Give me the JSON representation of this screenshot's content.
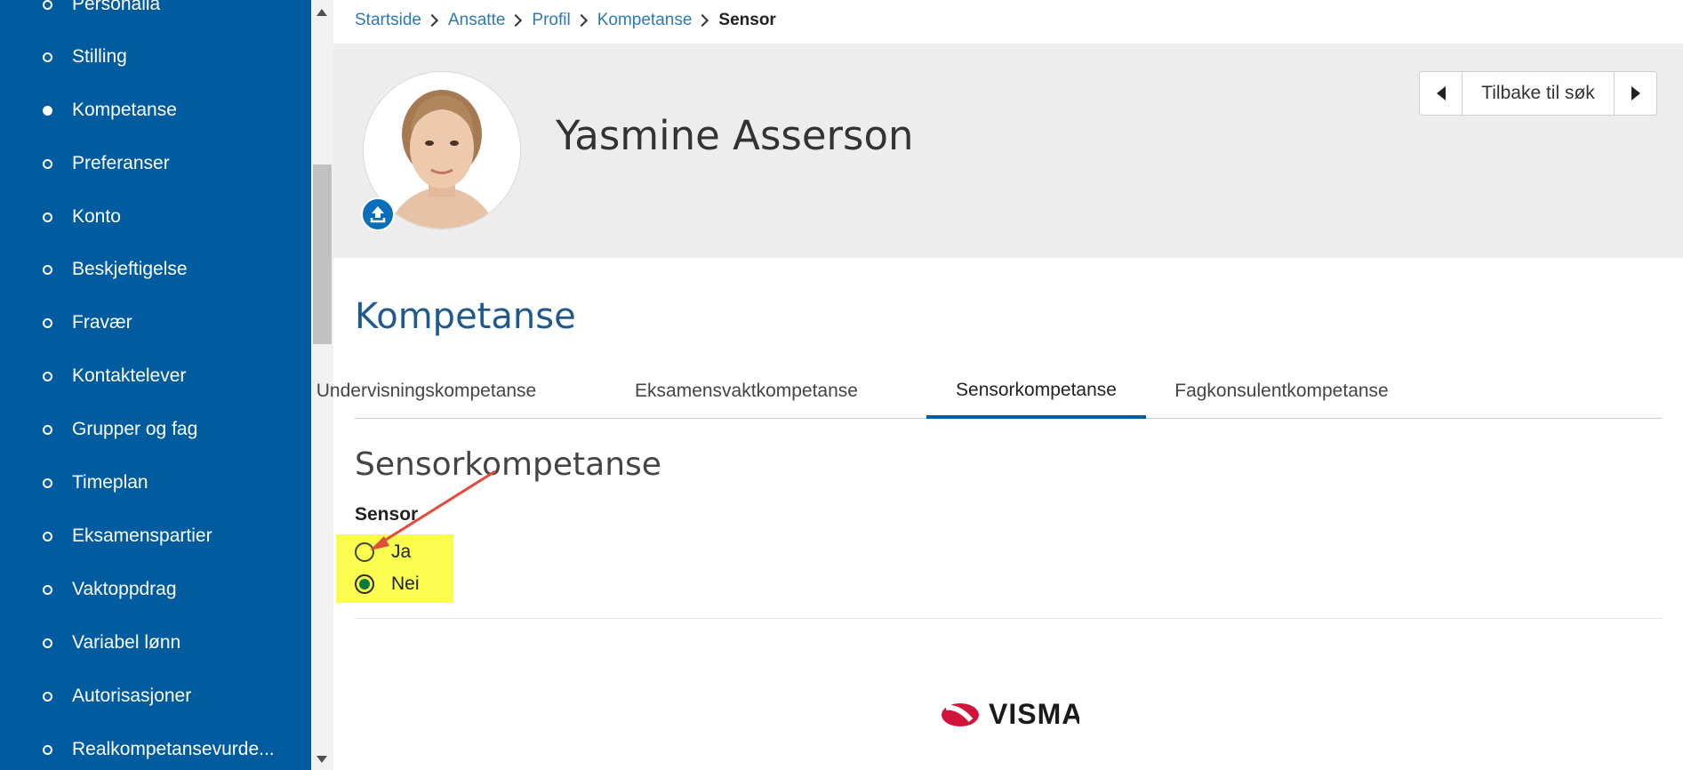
{
  "sidebar": {
    "items": [
      {
        "label": "Personalia",
        "active": false
      },
      {
        "label": "Stilling",
        "active": false
      },
      {
        "label": "Kompetanse",
        "active": true
      },
      {
        "label": "Preferanser",
        "active": false
      },
      {
        "label": "Konto",
        "active": false
      },
      {
        "label": "Beskjeftigelse",
        "active": false
      },
      {
        "label": "Fravær",
        "active": false
      },
      {
        "label": "Kontaktelever",
        "active": false
      },
      {
        "label": "Grupper og fag",
        "active": false
      },
      {
        "label": "Timeplan",
        "active": false
      },
      {
        "label": "Eksamenspartier",
        "active": false
      },
      {
        "label": "Vaktoppdrag",
        "active": false
      },
      {
        "label": "Variabel lønn",
        "active": false
      },
      {
        "label": "Autorisasjoner",
        "active": false
      },
      {
        "label": "Realkompetansevurde...",
        "active": false
      }
    ]
  },
  "breadcrumb": {
    "links": [
      "Startside",
      "Ansatte",
      "Profil",
      "Kompetanse"
    ],
    "current": "Sensor"
  },
  "profile": {
    "name": "Yasmine Asserson",
    "back_label": "Tilbake til søk"
  },
  "section": {
    "title": "Kompetanse",
    "tabs": [
      {
        "label": "Undervisningskompetanse",
        "active": false
      },
      {
        "label": "Eksamensvaktkompetanse",
        "active": false
      },
      {
        "label": "Sensorkompetanse",
        "active": true
      },
      {
        "label": "Fagkonsulentkompetanse",
        "active": false
      }
    ],
    "subtitle": "Sensorkompetanse",
    "field_label": "Sensor",
    "options": [
      {
        "label": "Ja",
        "checked": false
      },
      {
        "label": "Nei",
        "checked": true
      }
    ]
  },
  "footer": {
    "logo_text": "VISMA"
  },
  "colors": {
    "sidebar": "#005b9f",
    "link": "#2a7ab8",
    "highlight": "#fafc4e",
    "annotation_arrow": "#e04b3c",
    "logo_red": "#d1143a"
  }
}
